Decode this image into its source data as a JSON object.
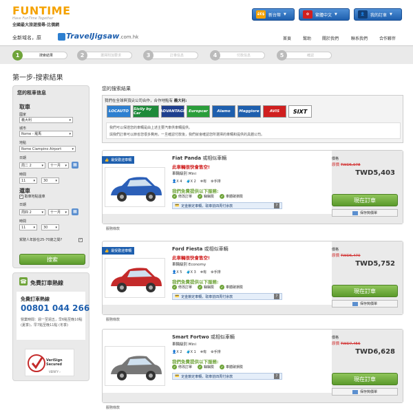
{
  "header": {
    "logo": "FUNTIME",
    "logo_sub1": "Have FunTime Together",
    "logo_sub2": "全國最大旅遊搜尋‧比價網",
    "currency_icon": "£€$",
    "currency_label": "新台幣",
    "lang_label": "繁體中文",
    "account_label": "我的訂車",
    "new_domain_label": "全新域名，原",
    "travel_jigsaw": "TravelJigsaw",
    "travel_jigsaw_suffix": ".com.hk",
    "nav": [
      "首頁",
      "幫助",
      "關於我們",
      "聯系我們",
      "合作夥伴"
    ]
  },
  "steps": [
    {
      "num": "1",
      "label": "搜索結果"
    },
    {
      "num": "2",
      "label": "選擇附加要求"
    },
    {
      "num": "3",
      "label": "訂車信息"
    },
    {
      "num": "4",
      "label": "付款信息"
    },
    {
      "num": "5",
      "label": "確認"
    }
  ],
  "page_title": "第一步-搜索結果",
  "sidebar": {
    "title": "您的租車信息",
    "pickup_title": "取車",
    "country_label": "國家",
    "country_value": "義大利",
    "city_label": "城市",
    "city_value": "Rome - 羅馬",
    "location_label": "地點",
    "location_value": "Rome Ciampino Airport",
    "date_label": "日期",
    "pickup_day": "周二 2",
    "pickup_month": "十一月",
    "time_label": "時間",
    "pickup_hour": "11",
    "pickup_min": "30",
    "return_title": "還車",
    "same_place_label": "取車地點還車",
    "return_date_label": "日期",
    "return_day": "周四 2",
    "return_month": "十一月",
    "return_time_label": "時間",
    "return_hour": "11",
    "return_min": "30",
    "age_label": "駕駛人年齡在25-70歲之間?",
    "search_label": "搜索",
    "hotline_title": "免費訂車熱線",
    "hotline_label": "免費訂車熱線",
    "hotline_number": "00801 044 266",
    "hotline_info": "營業時間：週一至週五，早6點至晚10點(夏季)，早7點至晚11點 (冬季)",
    "verisign_text": "VeriSign Secured",
    "verisign_verify": "VERIFY ›"
  },
  "main": {
    "header": "您的搜索結果",
    "partner_intro": "我們在全球與頂尖公司合作，合作地點有",
    "partner_country": "義大利:",
    "brands": [
      "LOCAUTO",
      "Sicily by Car",
      "ADVANTAGE",
      "Europcar",
      "Alamo",
      "Maggiore",
      "AVIS",
      "SIXT"
    ],
    "brand_colors": [
      "#2d7fd0",
      "#1e8a3a",
      "#1e3f8e",
      "#2a9d3a",
      "#1e5fae",
      "#1e5fae",
      "#d01f1f",
      "#fff"
    ],
    "info_line1": "我們可以保證您的車輛是由上述主要汽車供車輛提供。",
    "info_line2": "與我們訂車可以節省您很多費用，一旦確認付款後，我們就會確認您所選擇的車輛和提供的具體公司。"
  },
  "cars": [
    {
      "badge": "最受歡迎車輛",
      "name": "Fiat Panda",
      "name_suffix": "或相似車輛",
      "hurry": "此車輛很快會售空!",
      "class": "車輛級別 Mini",
      "seats": "X 4",
      "bags": "X 2",
      "ac": "有",
      "trans": "手排",
      "free_title": "我們免費提供以下服務:",
      "svc": [
        "修改訂單",
        "竊竊險",
        "車體破損險"
      ],
      "lock_text": "定金鎖定車輛，取車前四周付余款",
      "price_label": "價格",
      "orig_label": "原價",
      "orig_price": "TWD5,978",
      "price": "TWD5,403",
      "order_label": "現在訂車",
      "save_label": "保存夠價單",
      "terms": "服務條款",
      "color": "#2b5fb8"
    },
    {
      "badge": "最受歡迎車輛",
      "name": "Ford Fiesta",
      "name_suffix": "或相似車輛",
      "hurry": "此車輛很快會售空!",
      "class": "車輛級別 Economy",
      "seats": "X 5",
      "bags": "X 3",
      "ac": "有",
      "trans": "手排",
      "free_title": "我們免費提供以下服務:",
      "svc": [
        "修改訂單",
        "竊竊險",
        "車體破損險"
      ],
      "lock_text": "定金鎖定車輛，取車前四周付余款",
      "price_label": "價格",
      "orig_label": "原價",
      "orig_price": "TWD6,470",
      "price": "TWD5,752",
      "order_label": "現在訂車",
      "save_label": "保存夠價單",
      "terms": "服務條款",
      "color": "#c42a2a"
    },
    {
      "badge": "",
      "name": "Smart Fortwo",
      "name_suffix": "或相似車輛",
      "hurry": "",
      "class": "車輛級別 Mini",
      "seats": "X 2",
      "bags": "X 1",
      "ac": "有",
      "trans": "手排",
      "free_title": "我們免費提供以下服務:",
      "svc": [
        "修改訂單",
        "竊竊險",
        "車體破損險"
      ],
      "lock_text": "定金鎖定車輛，取車前四周付余款",
      "price_label": "價格",
      "orig_label": "原價",
      "orig_price": "TWD7,456",
      "price": "TWD6,628",
      "order_label": "現在訂車",
      "save_label": "保存夠價單",
      "terms": "服務條款",
      "color": "#777"
    }
  ]
}
